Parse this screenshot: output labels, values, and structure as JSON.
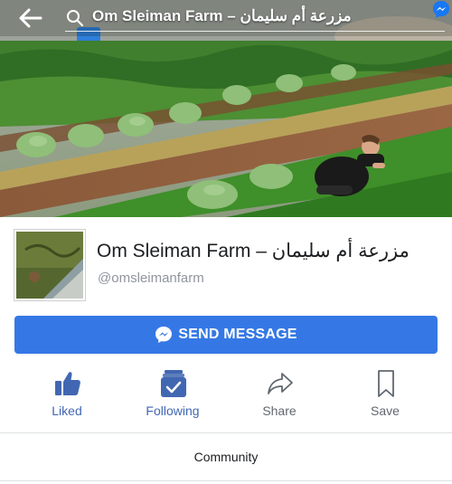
{
  "colors": {
    "accent": "#3578e5",
    "active": "#4267b2",
    "muted": "#606770"
  },
  "header": {
    "search_text": "Om Sleiman Farm – مزرعة أم سليمان",
    "back_icon": "arrow-left-icon",
    "search_icon": "search-icon",
    "messenger_icon": "messenger-icon"
  },
  "page": {
    "name": "Om Sleiman Farm – مزرعة أم سليمان",
    "handle": "@omsleimanfarm"
  },
  "send_message": {
    "label": "SEND MESSAGE",
    "icon": "messenger-icon"
  },
  "actions": [
    {
      "label": "Liked",
      "icon": "thumbs-up-icon",
      "active": true
    },
    {
      "label": "Following",
      "icon": "following-check-icon",
      "active": true
    },
    {
      "label": "Share",
      "icon": "share-arrow-icon",
      "active": false
    },
    {
      "label": "Save",
      "icon": "bookmark-icon",
      "active": false
    }
  ],
  "tabs": {
    "community": "Community"
  }
}
